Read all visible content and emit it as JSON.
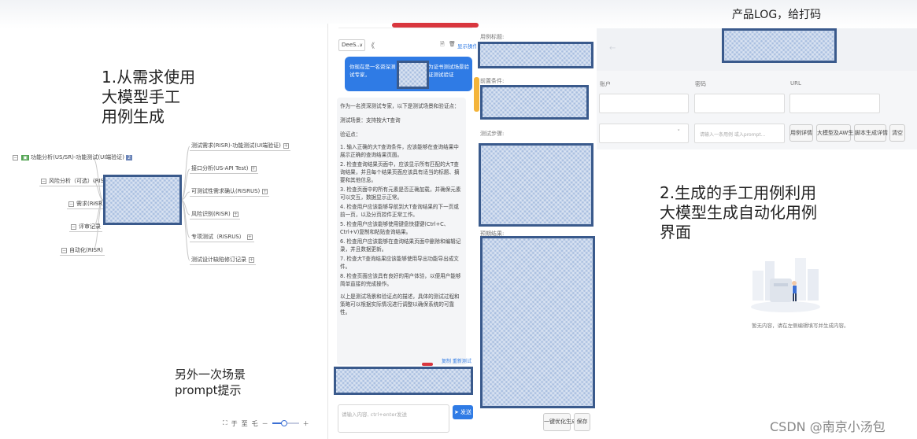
{
  "annotations": {
    "top_right": "产品LOG，给打码",
    "section1_lines": [
      "1.从需求使用",
      "大模型手工",
      "用例生成"
    ],
    "section2_lines": [
      "2.生成的手工用例利用",
      "大模型生成自动化用例",
      "界面"
    ],
    "scene_lines": [
      "另外一次场景",
      "prompt提示"
    ],
    "watermark": "CSDN @南京小汤包"
  },
  "mindmap": {
    "root_label": "功能分析(US/SR)-功能测试(UI端验证)",
    "root_badge": "2",
    "left_nodes": [
      "风险分析（可选）(RISRUS)",
      "需求(RISR)",
      "评审记录",
      "自动化(RISR)"
    ],
    "right_nodes": [
      "测试需求(RISR)-功能测试(UI端验证)",
      "接口分析(US-API Test)",
      "可测试性需求确认(RISRUS)",
      "风险识别(RISR)",
      "专项测试（RISRUS）",
      "测试设计缺陷修订记录"
    ],
    "toolbar": [
      "⛶",
      "于",
      "至",
      "乇",
      "－",
      "＋"
    ],
    "zoom_level": 0.45
  },
  "chat": {
    "model_select": "DeeS...",
    "back_glyph": "《",
    "top_icons": [
      "🗎",
      "🗑"
    ],
    "top_link": "显示操作",
    "user_msg_left": "你现在是一名资深测试专家，",
    "user_msg_right": "为证书测试场景验证测试验证",
    "response": [
      "作为一名资深测试专家，以下是测试场景和验证点：",
      "测试场景：支持按大T查询",
      "验证点：",
      "1. 输入正确的大T查询条件，应该能够在查询结果中展示正确的查询结果页面。",
      "2. 检查查询结果页面中，应该显示所有匹配的大T查询结果，并且每个结果页面应该具有适当的标题、摘要和其他信息。",
      "3. 检查页面中的所有元素是否正确加载，并确保元素可以交互，数据显示正常。",
      "4. 检查用户应该能够导航到大T查询结果的下一页或前一页，以及分页控件正常工作。",
      "5. 检查用户应该能够使用键盘快捷键(Ctrl+C、Ctrl+V)复制和粘贴查询结果。",
      "6. 检查用户应该能够在查询结果页面中删除和编辑记录，并且数据更新。",
      "7. 检查大T查询结果应该能够使用导出功能导出成文件。",
      "8. 检查页面应该具有良好的用户体验，以便用户能够简单直接的完成操作。",
      "以上是测试场景和验证点的描述，具体的测试过程和策略可以根据实际情况进行调整以确保系统的可靠性。"
    ],
    "response_actions": "复制  重新测试",
    "input_placeholder": "请输入内容, ctrl+enter发送",
    "send_label": "发送"
  },
  "case_form": {
    "labels": [
      "用例标题:",
      "前置条件:",
      "测试步骤:",
      "预期结果:"
    ],
    "buttons": [
      "一键优化生成",
      "保存"
    ]
  },
  "auto_panel": {
    "header_arrow": "←",
    "fields": [
      "账户",
      "密码",
      "URL"
    ],
    "row2_select_arrow": "˅",
    "row2_placeholder": "请输入一条用例 或入prompt...",
    "buttons": [
      "用例详情",
      "大模型及AW生成",
      "脚本生成详情",
      "清空"
    ],
    "empty_text": "暂无内容，请在左侧编辑填写并生成内容。"
  },
  "colors": {
    "mask_fill": "#a9bfe0",
    "mask_border": "#3a5a8c",
    "chat_bubble": "#2f7be5",
    "link": "#2f7be5"
  }
}
